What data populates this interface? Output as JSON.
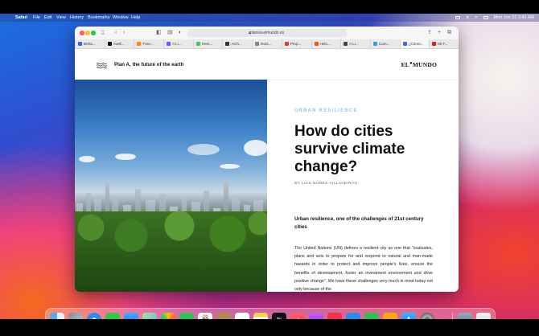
{
  "menubar": {
    "app_name": "Safari",
    "items": [
      "File",
      "Edit",
      "View",
      "History",
      "Bookmarks",
      "Window",
      "Help"
    ],
    "datetime": "Mon Jun 22  9:41 AM"
  },
  "browser": {
    "url": "planea.elmundo.es",
    "tabs": [
      "Beha...",
      "Avell...",
      "Free...",
      "A Li...",
      "Hem...",
      "Arch...",
      "Doct...",
      "Prop...",
      "Helo...",
      "A Li...",
      "Cam...",
      "¿Cómo...",
      "Mi F..."
    ],
    "tab_colors": [
      "#2f6de1",
      "#111111",
      "#ff8a00",
      "#7b4dff",
      "#4cc36b",
      "#333333",
      "#888888",
      "#e03a3a",
      "#e85a1a",
      "#444444",
      "#3b9ed9",
      "#3b6fd6",
      "#e02020"
    ]
  },
  "site": {
    "title": "Plan A, the future of the earth",
    "logo_main": "EL",
    "logo_mid": "●",
    "logo_end": "MUNDO"
  },
  "article": {
    "kicker": "URBAN RESILIENCE",
    "headline": "How do cities survive climate change?",
    "byline": "BY LUIS NÚÑEZ-VILLAVEIRÁN",
    "lead": "Urban resilience, one of the challenges of 21st century cities",
    "body": "The United Nations (UN) defines a resilient city as one that \"evaluates, plans and acts to prepare for and respond to natural and man-made hazards in order to protect and improve people's lives, ensure the benefits of development, foster an investment environment and drive positive change\". We have these challenges very much in mind today not only because of the"
  },
  "dock": {
    "calendar_month": "JUN",
    "calendar_day": "22",
    "tv_label": "tv",
    "icons": [
      "finder-icon",
      "launchpad-icon",
      "safari-icon",
      "messages-icon",
      "mail-icon",
      "maps-icon",
      "photos-icon",
      "facetime-icon",
      "calendar-icon",
      "contacts-icon",
      "reminders-icon",
      "notes-icon",
      "tv-icon",
      "music-icon",
      "podcasts-icon",
      "news-icon",
      "keynote-icon",
      "numbers-icon",
      "pages-icon",
      "app-store-icon",
      "system-preferences-icon",
      "preview-icon",
      "trash-icon"
    ]
  }
}
